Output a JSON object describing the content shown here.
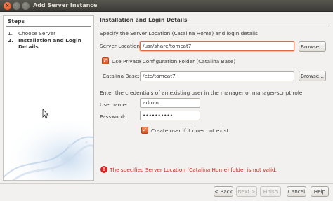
{
  "window": {
    "title": "Add Server Instance"
  },
  "steps": {
    "heading": "Steps",
    "items": [
      {
        "num": "1.",
        "label": "Choose Server"
      },
      {
        "num": "2.",
        "label": "Installation and Login Details"
      }
    ]
  },
  "content": {
    "heading": "Installation and Login Details",
    "intro": "Specify the Server Location (Catalina Home) and login details",
    "server_location_label": "Server Location:",
    "server_location_value": "/usr/share/tomcat7",
    "browse_label": "Browse...",
    "use_private_config_label": "Use Private Configuration Folder (Catalina Base)",
    "catalina_base_label": "Catalina Base:",
    "catalina_base_value": "/etc/tomcat7",
    "credentials_intro": "Enter the credentials of an existing user in the manager or manager-script role",
    "username_label": "Username:",
    "username_value": "admin",
    "password_label": "Password:",
    "password_value": "••••••••••",
    "create_user_label": "Create user if it does not exist",
    "error_message": "The specified Server Location (Catalina Home) folder is not valid."
  },
  "buttons": {
    "back": "< Back",
    "next": "Next >",
    "finish": "Finish",
    "cancel": "Cancel",
    "help": "Help"
  },
  "colors": {
    "accent": "#dd4814",
    "error": "#c8281f"
  }
}
